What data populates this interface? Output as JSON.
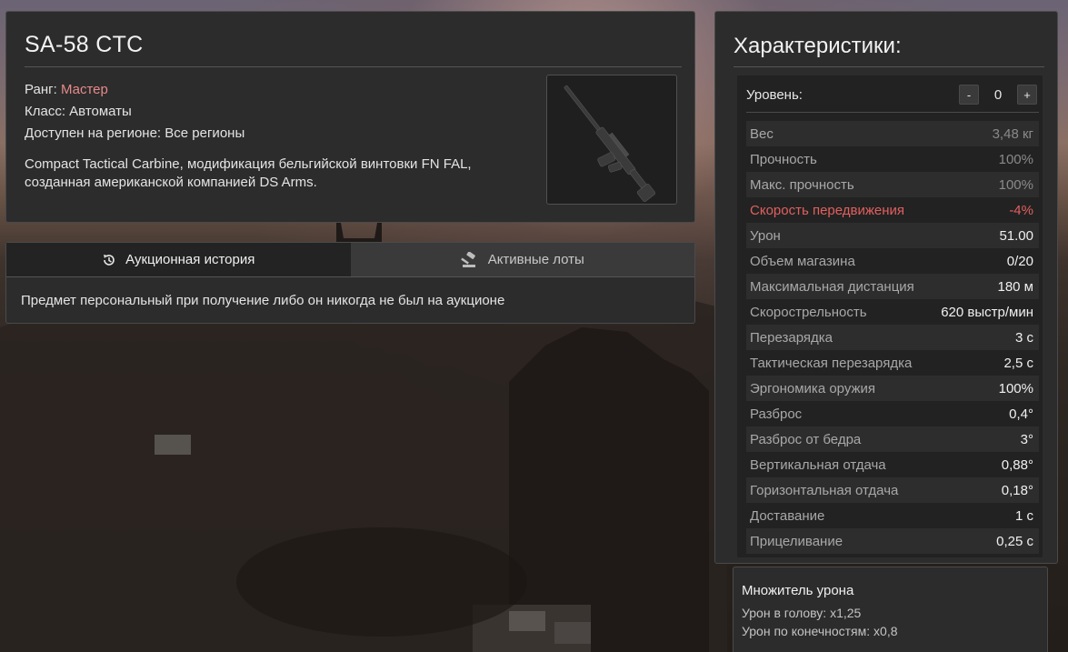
{
  "item": {
    "name": "SA-58 CTC",
    "rank_label": "Ранг:",
    "rank_value": "Мастер",
    "class_label": "Класс:",
    "class_value": "Автоматы",
    "region_label": "Доступен на регионе:",
    "region_value": "Все регионы",
    "description": "Compact Tactical Carbine, модификация бельгийской винтовки FN FAL, созданная американской компанией DS Arms.",
    "rank_color": "#e88a8a"
  },
  "auction": {
    "tabs": [
      {
        "label": "Аукционная история",
        "icon": "history-icon",
        "active": true
      },
      {
        "label": "Активные лоты",
        "icon": "gavel-icon",
        "active": false
      }
    ],
    "message": "Предмет персональный при получение либо он никогда не был на аукционе"
  },
  "stats": {
    "title": "Характеристики:",
    "level_label": "Уровень:",
    "level_value": "0",
    "minus_label": "-",
    "plus_label": "+",
    "rows": [
      {
        "label": "Вес",
        "value": "3,48 кг",
        "style": "dim"
      },
      {
        "label": "Прочность",
        "value": "100%",
        "style": "dim"
      },
      {
        "label": "Макс. прочность",
        "value": "100%",
        "style": "dim"
      },
      {
        "label": "Скорость передвижения",
        "value": "-4%",
        "style": "negative"
      },
      {
        "label": "Урон",
        "value": "51.00",
        "style": ""
      },
      {
        "label": "Объем магазина",
        "value": "0/20",
        "style": ""
      },
      {
        "label": "Максимальная дистанция",
        "value": "180 м",
        "style": ""
      },
      {
        "label": "Скорострельность",
        "value": "620 выстр/мин",
        "style": ""
      },
      {
        "label": "Перезарядка",
        "value": "3 с",
        "style": ""
      },
      {
        "label": "Тактическая перезарядка",
        "value": "2,5 с",
        "style": ""
      },
      {
        "label": "Эргономика оружия",
        "value": "100%",
        "style": ""
      },
      {
        "label": "Разброс",
        "value": "0,4°",
        "style": ""
      },
      {
        "label": "Разброс от бедра",
        "value": "3°",
        "style": ""
      },
      {
        "label": "Вертикальная отдача",
        "value": "0,88°",
        "style": ""
      },
      {
        "label": "Горизонтальная отдача",
        "value": "0,18°",
        "style": ""
      },
      {
        "label": "Доставание",
        "value": "1 с",
        "style": ""
      },
      {
        "label": "Прицеливание",
        "value": "0,25 с",
        "style": ""
      }
    ],
    "negative_color": "#e0605e"
  },
  "damage_multiplier": {
    "title": "Множитель урона",
    "head": "Урон в голову: x1,25",
    "limbs": "Урон по конечностям: x0,8"
  }
}
